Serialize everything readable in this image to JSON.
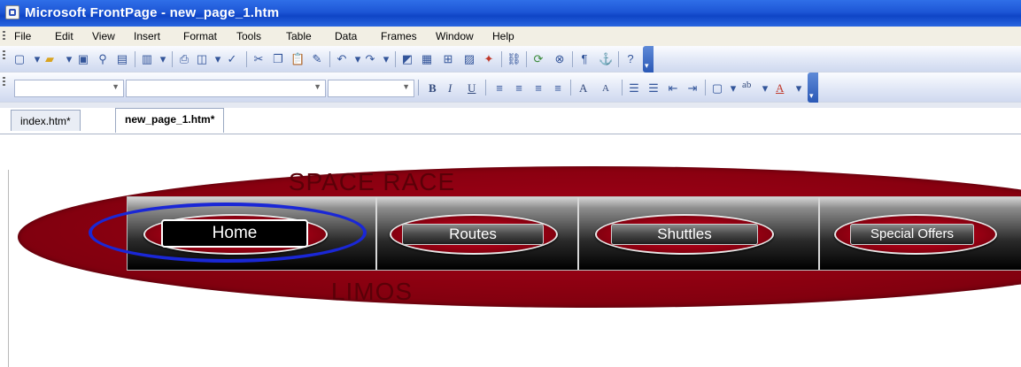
{
  "window": {
    "title": "Microsoft FrontPage - new_page_1.htm"
  },
  "menubar": {
    "items": [
      "File",
      "Edit",
      "View",
      "Insert",
      "Format",
      "Tools",
      "Table",
      "Data",
      "Frames",
      "Window",
      "Help"
    ]
  },
  "toolbars": {
    "standard_icons": [
      "new-page-icon",
      "open-icon",
      "save-icon",
      "search-icon",
      "publish-icon",
      "folder-list-icon",
      "print-icon",
      "print-preview-icon",
      "spelling-icon",
      "cut-icon",
      "copy-icon",
      "paste-icon",
      "format-painter-icon",
      "undo-icon",
      "redo-icon",
      "web-component-icon",
      "insert-table-icon",
      "insert-layer-icon",
      "insert-picture-icon",
      "drawing-icon",
      "hyperlink-icon",
      "refresh-icon",
      "stop-icon",
      "show-all-icon",
      "help-icon"
    ],
    "formatting": {
      "style_value": "",
      "font_value": "",
      "size_value": "",
      "bold_label": "B",
      "italic_label": "I",
      "underline_label": "U",
      "increase_font_label": "A",
      "decrease_font_label": "A",
      "highlight_label": "ab",
      "font_color_label": "A"
    }
  },
  "tabs": [
    {
      "label": "index.htm*",
      "active": false
    },
    {
      "label": "new_page_1.htm*",
      "active": true
    }
  ],
  "page": {
    "banner_top": "SPACE RACE",
    "banner_bottom": "LIMOS",
    "nav_buttons": [
      {
        "label": "Home",
        "active": true
      },
      {
        "label": "Routes",
        "active": false
      },
      {
        "label": "Shuttles",
        "active": false
      },
      {
        "label": "Special Offers",
        "active": false
      }
    ],
    "highlight_color": "#1a27d6",
    "accent_red": "#a00014"
  }
}
